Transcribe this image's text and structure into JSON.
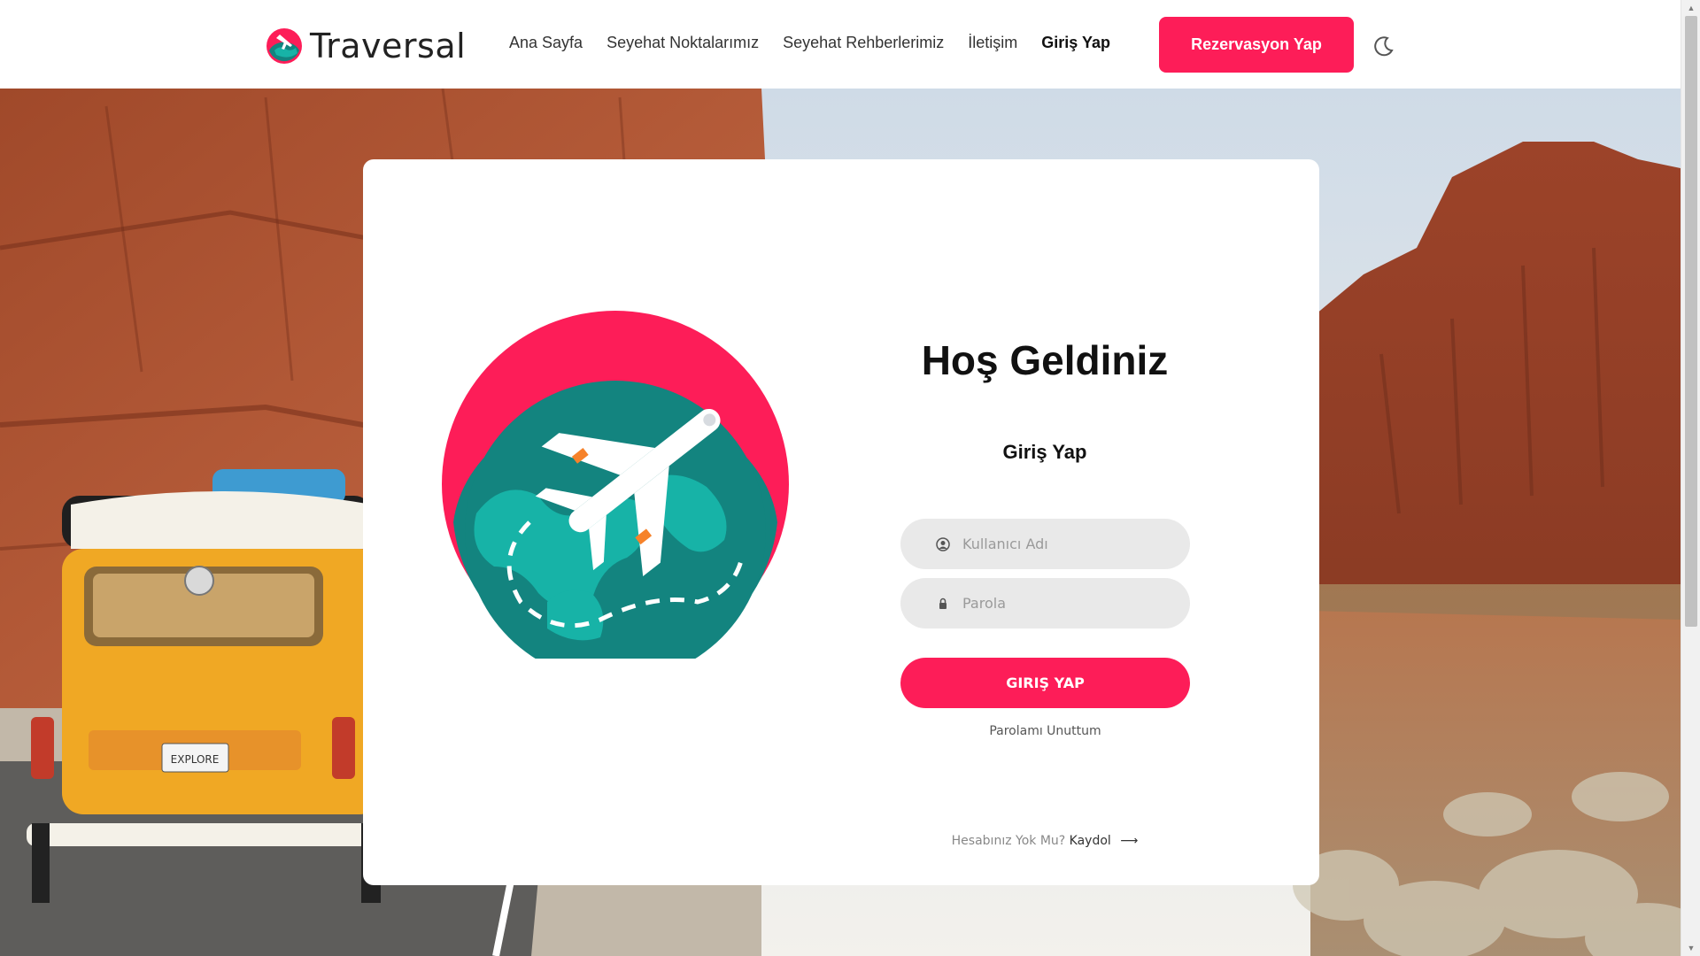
{
  "header": {
    "brand": "Traversal",
    "nav": [
      {
        "label": "Ana Sayfa"
      },
      {
        "label": "Seyehat Noktalarımız"
      },
      {
        "label": "Seyehat Rehberlerimiz"
      },
      {
        "label": "İletişim"
      },
      {
        "label": "Giriş Yap"
      }
    ],
    "reserve_label": "Rezervasyon Yap",
    "theme_icon": "moon-icon"
  },
  "login": {
    "title": "Hoş Geldiniz",
    "subtitle": "Giriş Yap",
    "username_placeholder": "Kullanıcı Adı",
    "password_placeholder": "Parola",
    "submit_label": "GIRIŞ YAP",
    "forgot_label": "Parolamı Unuttum",
    "signup_prompt": "Hesabınız Yok Mu?",
    "signup_label": "Kaydol"
  },
  "scene": {
    "plate_text": "EXPLORE"
  },
  "colors": {
    "accent": "#fd1d58",
    "globe_ocean": "#13847f",
    "globe_land": "#17b3a7",
    "field_bg": "#e9e9e9"
  }
}
